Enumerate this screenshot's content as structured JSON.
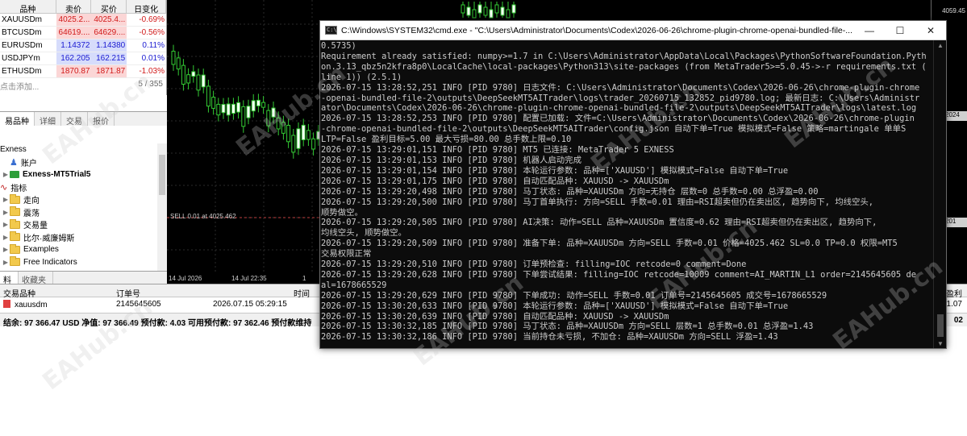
{
  "market_watch": {
    "headers": [
      "品种",
      "卖价",
      "买价",
      "日变化"
    ],
    "rows": [
      {
        "symbol": "XAUUSDm",
        "bid": "4025.2...",
        "ask": "4025.4...",
        "change": "-0.69%",
        "dir": "neg"
      },
      {
        "symbol": "BTCUSDm",
        "bid": "64619....",
        "ask": "64629....",
        "change": "-0.56%",
        "dir": "neg"
      },
      {
        "symbol": "EURUSDm",
        "bid": "1.14372",
        "ask": "1.14380",
        "change": "0.11%",
        "dir": "pos"
      },
      {
        "symbol": "USDJPYm",
        "bid": "162.205",
        "ask": "162.215",
        "change": "0.01%",
        "dir": "pos"
      },
      {
        "symbol": "ETHUSDm",
        "bid": "1870.87",
        "ask": "1871.87",
        "change": "-1.03%",
        "dir": "neg"
      }
    ],
    "footer_add": "点击添加...",
    "footer_count": "5 / 355",
    "tabs": [
      "易品种",
      "详细",
      "交易",
      "报价"
    ]
  },
  "navigator": {
    "items": [
      {
        "label": "Exness",
        "kind": "root"
      },
      {
        "label": "账户",
        "kind": "user"
      },
      {
        "label": "Exness-MT5Trial5",
        "kind": "account"
      },
      {
        "label": "指标",
        "kind": "indicator"
      },
      {
        "label": "走向",
        "kind": "folder"
      },
      {
        "label": "震荡",
        "kind": "folder"
      },
      {
        "label": "交易量",
        "kind": "folder"
      },
      {
        "label": "比尔·威廉姆斯",
        "kind": "folder"
      },
      {
        "label": "Examples",
        "kind": "folder"
      },
      {
        "label": "Free Indicators",
        "kind": "folder"
      }
    ],
    "tabs": [
      "料",
      "收藏夹"
    ]
  },
  "chart": {
    "sell_label": "SELL 0.01 at 4025.462",
    "price_top": "4059.45",
    "price_tag_1": "2024",
    "price_tag_2": "201",
    "time_labels": [
      "14 Jul 2026",
      "14 Jul 22:35",
      "1"
    ]
  },
  "terminal": {
    "headers": [
      "交易品种",
      "订单号",
      "时间",
      "盈利"
    ],
    "row": {
      "symbol": "xauusdm",
      "order": "2145645605",
      "time": "2026.07.15 05:29:15",
      "profit": "1.07"
    },
    "status": "结余: 97 366.47 USD  净值: 97 366.49  预付款: 4.03  可用预付款: 97 362.46  预付款维持",
    "status_right": "02"
  },
  "cmd": {
    "title": "C:\\Windows\\SYSTEM32\\cmd.exe - \"C:\\Users\\Administrator\\Documents\\Codex\\2026-06-26\\chrome-plugin-chrome-openai-bundled-file-...",
    "lines": [
      "0.5735)",
      "Requirement already satisfied: numpy>=1.7 in C:\\Users\\Administrator\\AppData\\Local\\Packages\\PythonSoftwareFoundation.Pyth",
      "on.3.13_qbz5n2kfra8p0\\LocalCache\\local-packages\\Python313\\site-packages (from MetaTrader5>=5.0.45->-r requirements.txt (",
      "line 1)) (2.5.1)",
      "2026-07-15 13:28:52,251 INFO [PID 9780] 日志文件: C:\\Users\\Administrator\\Documents\\Codex\\2026-06-26\\chrome-plugin-chrome",
      "-openai-bundled-file-2\\outputs\\DeepSeekMT5AITrader\\logs\\trader_20260715_132852_pid9780.log; 最新日志: C:\\Users\\Administr",
      "ator\\Documents\\Codex\\2026-06-26\\chrome-plugin-chrome-openai-bundled-file-2\\outputs\\DeepSeekMT5AITrader\\logs\\latest.log",
      "2026-07-15 13:28:52,253 INFO [PID 9780] 配置已加载: 文件=C:\\Users\\Administrator\\Documents\\Codex\\2026-06-26\\chrome-plugin",
      "-chrome-openai-bundled-file-2\\outputs\\DeepSeekMT5AITrader\\config.json 自动下单=True 模拟模式=False 策略=martingale 单单S",
      "LTP=False 盈利目标=5.00 最大亏损=80.00 总手数上限=0.10",
      "2026-07-15 13:29:01,151 INFO [PID 9780] MT5 已连接: MetaTrader 5 EXNESS",
      "2026-07-15 13:29:01,153 INFO [PID 9780] 机器人启动完成",
      "2026-07-15 13:29:01,154 INFO [PID 9780] 本轮运行参数: 品种=['XAUUSD'] 模拟模式=False 自动下单=True",
      "2026-07-15 13:29:01,175 INFO [PID 9780] 自动匹配品种: XAUUSD -> XAUUSDm",
      "2026-07-15 13:29:20,498 INFO [PID 9780] 马丁状态: 品种=XAUUSDm 方向=无持仓 层数=0 总手数=0.00 总浮盈=0.00",
      "2026-07-15 13:29:20,500 INFO [PID 9780] 马丁首单执行: 方向=SELL 手数=0.01 理由=RSI超卖但仍在卖出区, 趋势向下, 均线空头,",
      "顺势做空。",
      "2026-07-15 13:29:20,505 INFO [PID 9780] AI决策: 动作=SELL 品种=XAUUSDm 置信度=0.62 理由=RSI超卖但仍在卖出区, 趋势向下,",
      "均线空头, 顺势做空。",
      "2026-07-15 13:29:20,509 INFO [PID 9780] 准备下单: 品种=XAUUSDm 方向=SELL 手数=0.01 价格=4025.462 SL=0.0 TP=0.0 权限=MT5",
      "交易权限正常",
      "2026-07-15 13:29:20,510 INFO [PID 9780] 订单预检查: filling=IOC retcode=0 comment=Done",
      "2026-07-15 13:29:20,628 INFO [PID 9780] 下单尝试结果: filling=IOC retcode=10009 comment=AI_MARTIN_L1 order=2145645605 de",
      "al=1678665529",
      "2026-07-15 13:29:20,629 INFO [PID 9780] 下单成功: 动作=SELL 手数=0.01 订单号=2145645605 成交号=1678665529",
      "2026-07-15 13:30:20,633 INFO [PID 9780] 本轮运行参数: 品种=['XAUUSD'] 模拟模式=False 自动下单=True",
      "2026-07-15 13:30:20,639 INFO [PID 9780] 自动匹配品种: XAUUSD -> XAUUSDm",
      "2026-07-15 13:30:32,185 INFO [PID 9780] 马丁状态: 品种=XAUUSDm 方向=SELL 层数=1 总手数=0.01 总浮盈=1.43",
      "2026-07-15 13:30:32,186 INFO [PID 9780] 当前持仓未亏损, 不加仓: 品种=XAUUSDm 方向=SELL 浮盈=1.43"
    ]
  },
  "watermark": "EAHub.cn"
}
